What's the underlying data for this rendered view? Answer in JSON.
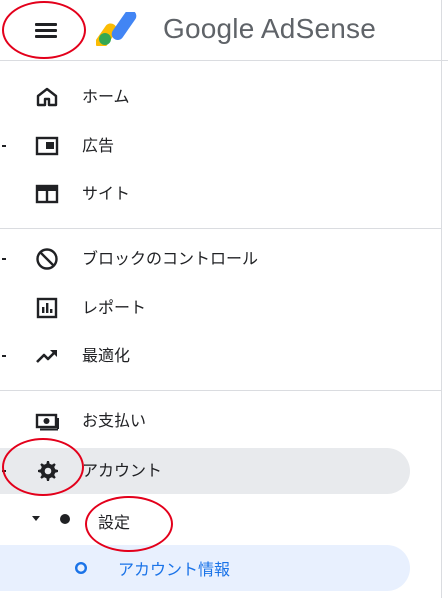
{
  "header": {
    "brand": "Google AdSense"
  },
  "nav": {
    "items": [
      {
        "label": "ホーム",
        "icon": "home-icon"
      },
      {
        "label": "広告",
        "icon": "ads-icon"
      },
      {
        "label": "サイト",
        "icon": "sites-icon"
      },
      {
        "label": "ブロックのコントロール",
        "icon": "block-icon"
      },
      {
        "label": "レポート",
        "icon": "report-icon"
      },
      {
        "label": "最適化",
        "icon": "trending-up-icon"
      },
      {
        "label": "お支払い",
        "icon": "payments-icon"
      },
      {
        "label": "アカウント",
        "icon": "gear-icon"
      }
    ],
    "sub": {
      "settings_label": "設定",
      "account_info_label": "アカウント情報"
    }
  },
  "colors": {
    "annotation": "#e3001b",
    "active_bg": "#e8eaed",
    "sub_active_bg": "#e8f0fe",
    "sub_active_text": "#1a73e8"
  }
}
